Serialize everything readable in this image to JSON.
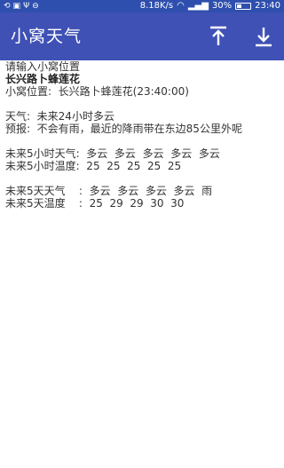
{
  "status_bar": {
    "left_icons": [
      "sync-icon",
      "image-icon",
      "psi-icon",
      "minus-circle-icon"
    ],
    "net_speed": "8.18K/s",
    "battery": "30%",
    "battery_level": 0.3,
    "time": "23:40"
  },
  "app_bar": {
    "title": "小窝天气",
    "upload_icon": "upload-icon",
    "download_icon": "download-icon"
  },
  "content": {
    "input_prompt": "请输入小窝位置",
    "location_name": "长兴路卜蜂莲花",
    "current_location": "小窝位置:  长兴路卜蜂莲花(23:40:00)",
    "weather": "天气:  未来24小时多云",
    "forecast": "预报:  不会有雨，最近的降雨带在东边85公里外呢",
    "hourly_weather": "未来5小时天气:  多云  多云  多云  多云  多云",
    "hourly_temp": "未来5小时温度:  25  25  25  25  25",
    "daily_weather": "未来5天天气    :  多云  多云  多云  多云  雨",
    "daily_temp": "未来5天温度    :  25  29  29  30  30"
  }
}
